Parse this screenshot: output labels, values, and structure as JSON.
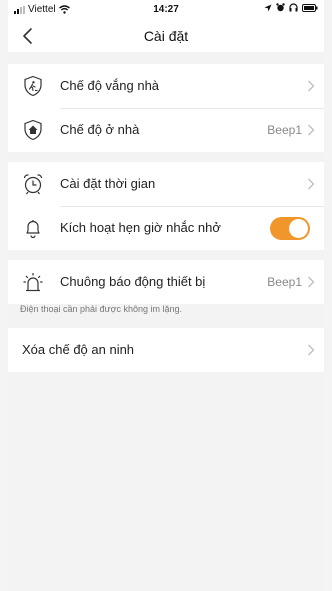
{
  "status_bar": {
    "carrier": "Viettel",
    "time": "14:27"
  },
  "header": {
    "title": "Cài đặt"
  },
  "security_modes": [
    {
      "label": "Chế độ vắng nhà",
      "value": "",
      "icon": "away-mode-shield-icon"
    },
    {
      "label": "Chế độ ở nhà",
      "value": "Beep1",
      "icon": "home-mode-shield-icon"
    }
  ],
  "timer": {
    "time_settings_label": "Cài đặt thời gian",
    "reminder_label": "Kích hoạt hẹn giờ nhắc nhở",
    "reminder_enabled": true
  },
  "alarm": {
    "label": "Chuông báo động thiết bị",
    "value": "Beep1",
    "note": "Điện thoại cần phải được không im lặng."
  },
  "clear_security": {
    "label": "Xóa chế độ an ninh"
  },
  "colors": {
    "accent": "#f0962b",
    "background": "#f3f3f3"
  }
}
